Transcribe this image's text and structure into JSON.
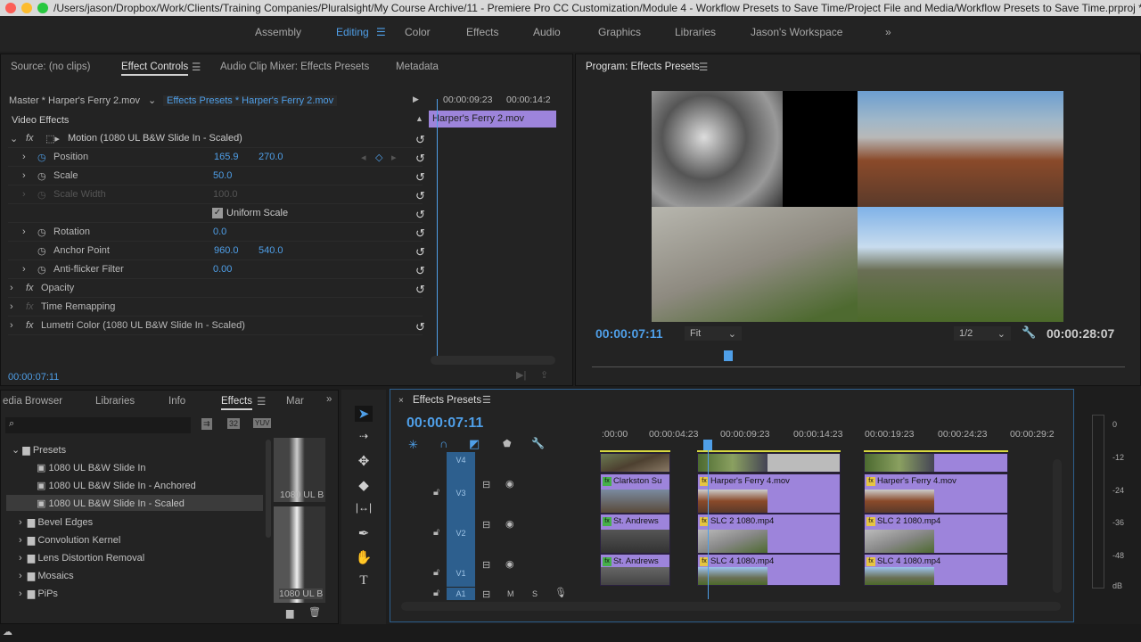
{
  "window": {
    "title": "/Users/jason/Dropbox/Work/Clients/Training Companies/Pluralsight/My Course Archive/11 - Premiere Pro CC Customization/Module 4 - Workflow Presets to Save Time/Project File and Media/Workflow Presets to Save Time.prproj *"
  },
  "workspaces": [
    "Assembly",
    "Editing",
    "Color",
    "Effects",
    "Audio",
    "Graphics",
    "Libraries",
    "Jason's Workspace"
  ],
  "workspace_active": "Editing",
  "source_panel": {
    "tabs": [
      "Source: (no clips)",
      "Effect Controls",
      "Audio Clip Mixer: Effects Presets",
      "Metadata"
    ],
    "master": "Master * Harper's Ferry 2.mov",
    "sequence_clip": "Effects Presets * Harper's Ferry 2.mov",
    "mini_times": [
      "00:00:09:23",
      "00:00:14:2"
    ],
    "mini_clip": "Harper's Ferry 2.mov",
    "section": "Video Effects",
    "motion": "Motion (1080 UL B&W Slide In - Scaled)",
    "props": [
      {
        "name": "Position",
        "v1": "165.9",
        "v2": "270.0"
      },
      {
        "name": "Scale",
        "v1": "50.0",
        "v2": ""
      },
      {
        "name": "Scale Width",
        "v1": "100.0",
        "v2": ""
      },
      {
        "name": "Uniform Scale",
        "v1": "",
        "v2": ""
      },
      {
        "name": "Rotation",
        "v1": "0.0",
        "v2": ""
      },
      {
        "name": "Anchor Point",
        "v1": "960.0",
        "v2": "540.0"
      },
      {
        "name": "Anti-flicker Filter",
        "v1": "0.00",
        "v2": ""
      }
    ],
    "opacity": "Opacity",
    "time_remap": "Time Remapping",
    "lumetri": "Lumetri Color (1080 UL B&W Slide In - Scaled)",
    "timecode": "00:00:07:11"
  },
  "program": {
    "title": "Program: Effects Presets",
    "timecode": "00:00:07:11",
    "fit": "Fit",
    "resolution": "1/2",
    "duration": "00:00:28:07"
  },
  "effects_panel": {
    "tabs": [
      "edia Browser",
      "Libraries",
      "Info",
      "Effects",
      "Mar"
    ],
    "search_placeholder": "",
    "badges": [
      "32",
      "YUV"
    ],
    "tree": [
      {
        "label": "Presets",
        "level": 0
      },
      {
        "label": "1080 UL B&W Slide In",
        "level": 1
      },
      {
        "label": "1080 UL B&W Slide In - Anchored",
        "level": 1
      },
      {
        "label": "1080 UL B&W Slide In - Scaled",
        "level": 1,
        "selected": true
      },
      {
        "label": "Bevel Edges",
        "level": 0
      },
      {
        "label": "Convolution Kernel",
        "level": 0
      },
      {
        "label": "Lens Distortion Removal",
        "level": 0
      },
      {
        "label": "Mosaics",
        "level": 0
      },
      {
        "label": "PiPs",
        "level": 0
      }
    ],
    "preview_labels": [
      "1080 UL B",
      "1080 UL B"
    ]
  },
  "timeline": {
    "title": "Effects Presets",
    "timecode": "00:00:07:11",
    "ruler": [
      ":00:00",
      "00:00:04:23",
      "00:00:09:23",
      "00:00:14:23",
      "00:00:19:23",
      "00:00:24:23",
      "00:00:29:2"
    ],
    "tracks": [
      "V4",
      "V3",
      "V2",
      "V1",
      "A1"
    ],
    "audio_buttons": [
      "M",
      "S"
    ],
    "clips": {
      "v3": [
        "Clarkston Su",
        "Harper's Ferry 4.mov",
        "Harper's Ferry 4.mov"
      ],
      "v2": [
        "St. Andrews",
        "SLC 2 1080.mp4",
        "SLC 2 1080.mp4"
      ],
      "v1": [
        "St. Andrews",
        "SLC 4 1080.mp4",
        "SLC 4 1080.mp4"
      ]
    }
  },
  "meter": {
    "labels": [
      "0",
      "-12",
      "-24",
      "-36",
      "-48",
      "dB"
    ]
  },
  "colors": {
    "accent": "#4f9fe8",
    "clip": "#9d84db",
    "track": "#2d5f8e"
  }
}
